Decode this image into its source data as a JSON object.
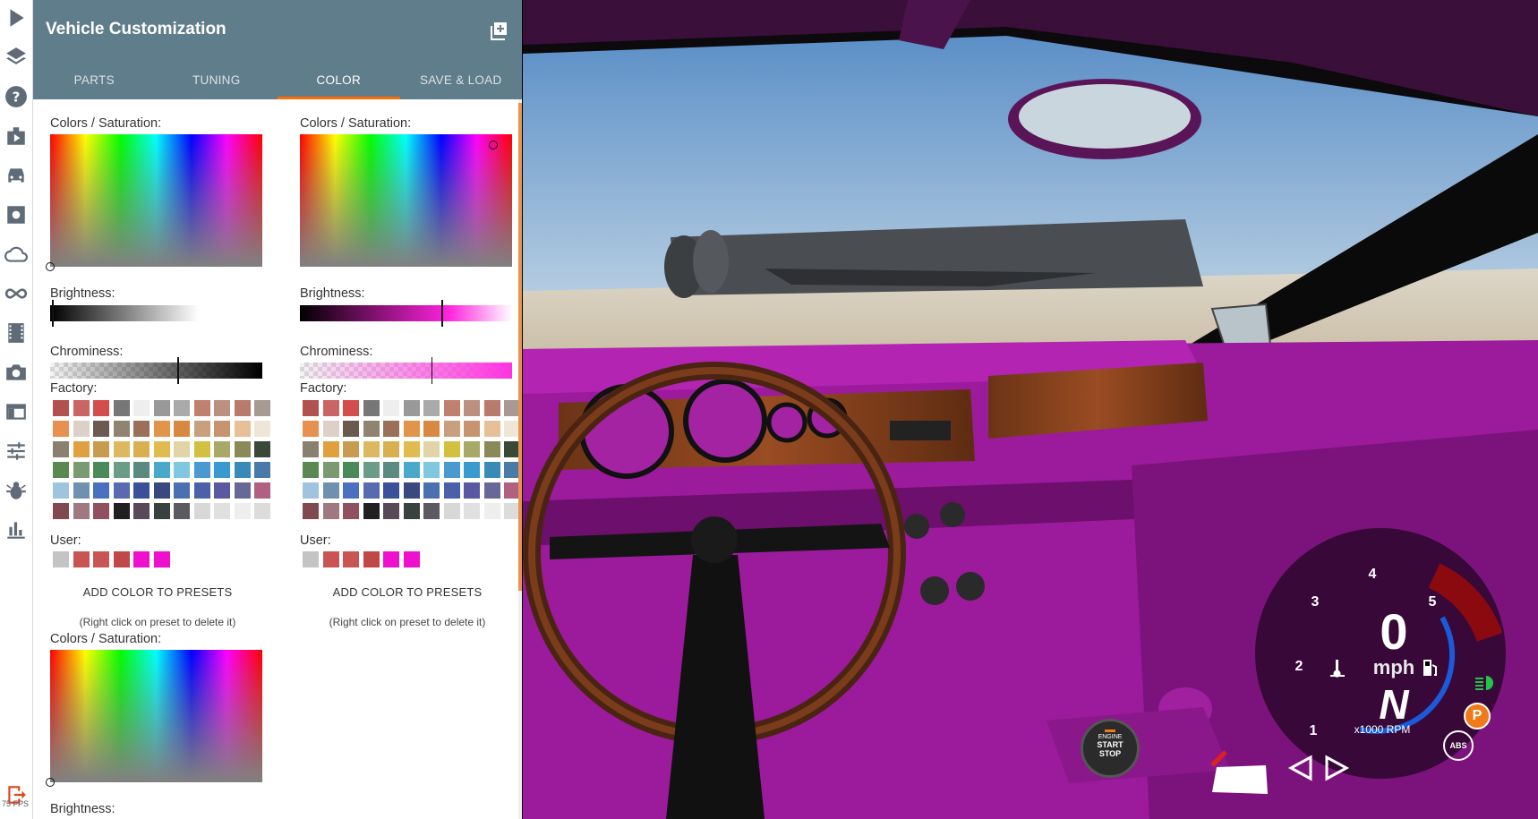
{
  "toolbar": {
    "items": [
      {
        "name": "play-icon"
      },
      {
        "name": "layers-icon"
      },
      {
        "name": "help-icon"
      },
      {
        "name": "scenario-icon"
      },
      {
        "name": "vehicle-icon"
      },
      {
        "name": "settings-icon"
      },
      {
        "name": "cloud-icon"
      },
      {
        "name": "infinity-icon"
      },
      {
        "name": "film-icon"
      },
      {
        "name": "camera-icon"
      },
      {
        "name": "window-icon"
      },
      {
        "name": "sliders-icon"
      },
      {
        "name": "bug-icon"
      },
      {
        "name": "stats-icon"
      }
    ],
    "exit_icon": "exit-icon",
    "fps": "75 FPS"
  },
  "panel": {
    "title": "Vehicle Customization",
    "tabs": [
      {
        "label": "PARTS",
        "active": false
      },
      {
        "label": "TUNING",
        "active": false
      },
      {
        "label": "COLOR",
        "active": true
      },
      {
        "label": "SAVE & LOAD",
        "active": false
      }
    ],
    "accent_color": "#ff6d00",
    "header_color": "#607d8b"
  },
  "pickers": [
    {
      "colors_label": "Colors / Saturation:",
      "brightness_label": "Brightness:",
      "brightness": 0.0,
      "brightness_gradient_end": "#ffffff",
      "chrominess_label": "Chrominess:",
      "chrominess": 0.6,
      "chrominess_color": "#000000",
      "factory_label": "Factory:",
      "user_label": "User:",
      "user_swatches": [
        "#c4c4c4",
        "#c85454",
        "#c85454",
        "#c04848",
        "#ee10cc",
        "#ee10cc"
      ],
      "add_label": "ADD COLOR TO PRESETS",
      "hint": "(Right click on preset to delete it)"
    },
    {
      "colors_label": "Colors / Saturation:",
      "brightness_label": "Brightness:",
      "brightness": 0.66,
      "brightness_gradient_end": "#ff22dd",
      "chrominess_label": "Chrominess:",
      "chrominess": 0.62,
      "chrominess_color": "#ff33e0",
      "factory_label": "Factory:",
      "user_label": "User:",
      "user_swatches": [
        "#c4c4c4",
        "#c85454",
        "#c85454",
        "#c04848",
        "#ee10cc",
        "#ee10cc"
      ],
      "add_label": "ADD COLOR TO PRESETS",
      "hint": "(Right click on preset to delete it)"
    },
    {
      "colors_label": "Colors / Saturation:",
      "brightness_label": "Brightness:"
    }
  ],
  "factory_swatches": [
    [
      "#b35050",
      "#c96565",
      "#d44d4d",
      "#777777",
      "#eeeeee",
      "#999999",
      "#aaaaaa",
      "#c08070",
      "#bb9080",
      "#b87a6a",
      "#a89a92"
    ],
    [
      "#e89050",
      "#ddd0c8",
      "#6a5a50",
      "#928270",
      "#9a7058",
      "#e0954a",
      "#d88840",
      "#c8a080",
      "#c89470",
      "#e8c098",
      "#f0e6d6"
    ],
    [
      "#8a8070",
      "#e0a040",
      "#c89c50",
      "#dcb860",
      "#d8b050",
      "#e0bc50",
      "#e0d4a8",
      "#d4c040",
      "#a8a868",
      "#8a8a58",
      "#3a4838"
    ],
    [
      "#5a8850",
      "#7a9a70",
      "#4a8a58",
      "#6a9c88",
      "#5a8a80",
      "#4aa8c8",
      "#80c8e0",
      "#4a9ad0",
      "#3a9ad0",
      "#3a8ab8",
      "#4a7aa8"
    ],
    [
      "#a0c4e0",
      "#7090b0",
      "#4a70c0",
      "#5a6ab0",
      "#3a5098",
      "#3a4880",
      "#4a70b0",
      "#4a60a8",
      "#5a58a0",
      "#686898",
      "#b06080"
    ],
    [
      "#804a50",
      "#a07880",
      "#905060",
      "#202020",
      "#584858",
      "#3a4240",
      "#5a5a60",
      "#d8d8d8",
      "#e0e0e0",
      "#eeeeee",
      "#dcdcdc"
    ]
  ],
  "scene": {
    "speed": "0",
    "speed_unit": "mph",
    "gear": "N",
    "rpm_label": "x1000 RPM",
    "rpm_ticks": [
      "1",
      "2",
      "3",
      "4",
      "5"
    ],
    "rpm_value": 0,
    "parking_label": "P",
    "abs_label": "ABS",
    "engine_top": "ENGINE",
    "engine_start": "START",
    "engine_stop": "STOP",
    "interior_color": "#9c1a9c"
  }
}
